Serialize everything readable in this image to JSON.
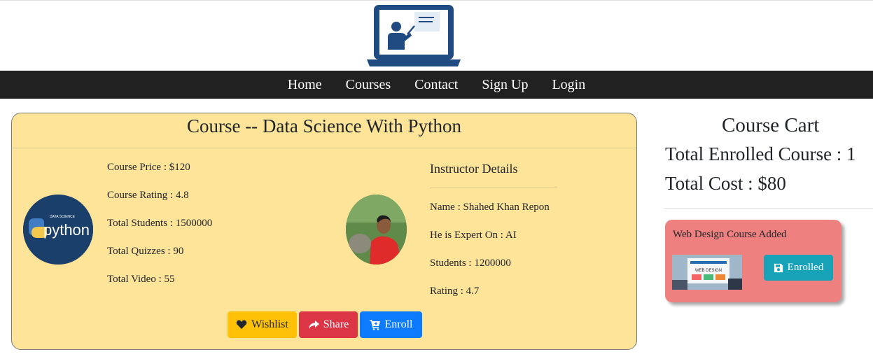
{
  "nav": {
    "home": "Home",
    "courses": "Courses",
    "contact": "Contact",
    "signup": "Sign Up",
    "login": "Login"
  },
  "course": {
    "title": "Course -- Data Science With Python",
    "image_text_small": "DATA SCIENCE",
    "image_text": "python",
    "price": "Course Price : $120",
    "rating": "Course Rating : 4.8",
    "students": "Total Students : 1500000",
    "quizzes": "Total Quizzes : 90",
    "videos": "Total Video : 55"
  },
  "instructor": {
    "heading": "Instructor Details",
    "name": "Name : Shahed Khan Repon",
    "expert": "He is Expert On : AI",
    "students": "Students : 1200000",
    "rating": "Rating : 4.7"
  },
  "buttons": {
    "wishlist": "Wishlist",
    "share": "Share",
    "enroll": "Enroll"
  },
  "cart": {
    "title": "Course Cart",
    "enrolled": "Total Enrolled Course : 1",
    "cost": "Total Cost : $80",
    "added_text": "Web Design Course Added",
    "added_image_text": "WEB DESIGN",
    "enrolled_button": "Enrolled"
  },
  "colors": {
    "navbar": "#212121",
    "card_bg": "#fde499",
    "wishlist": "#ffc107",
    "share": "#dc3545",
    "enroll": "#0d7bff",
    "added_card": "#ef8080",
    "enrolled_button": "#17a2b8"
  },
  "icons": {
    "logo": "teacher-laptop-logo",
    "wishlist": "heart-icon",
    "share": "share-icon",
    "enroll": "cart-icon",
    "enrolled": "save-icon"
  }
}
